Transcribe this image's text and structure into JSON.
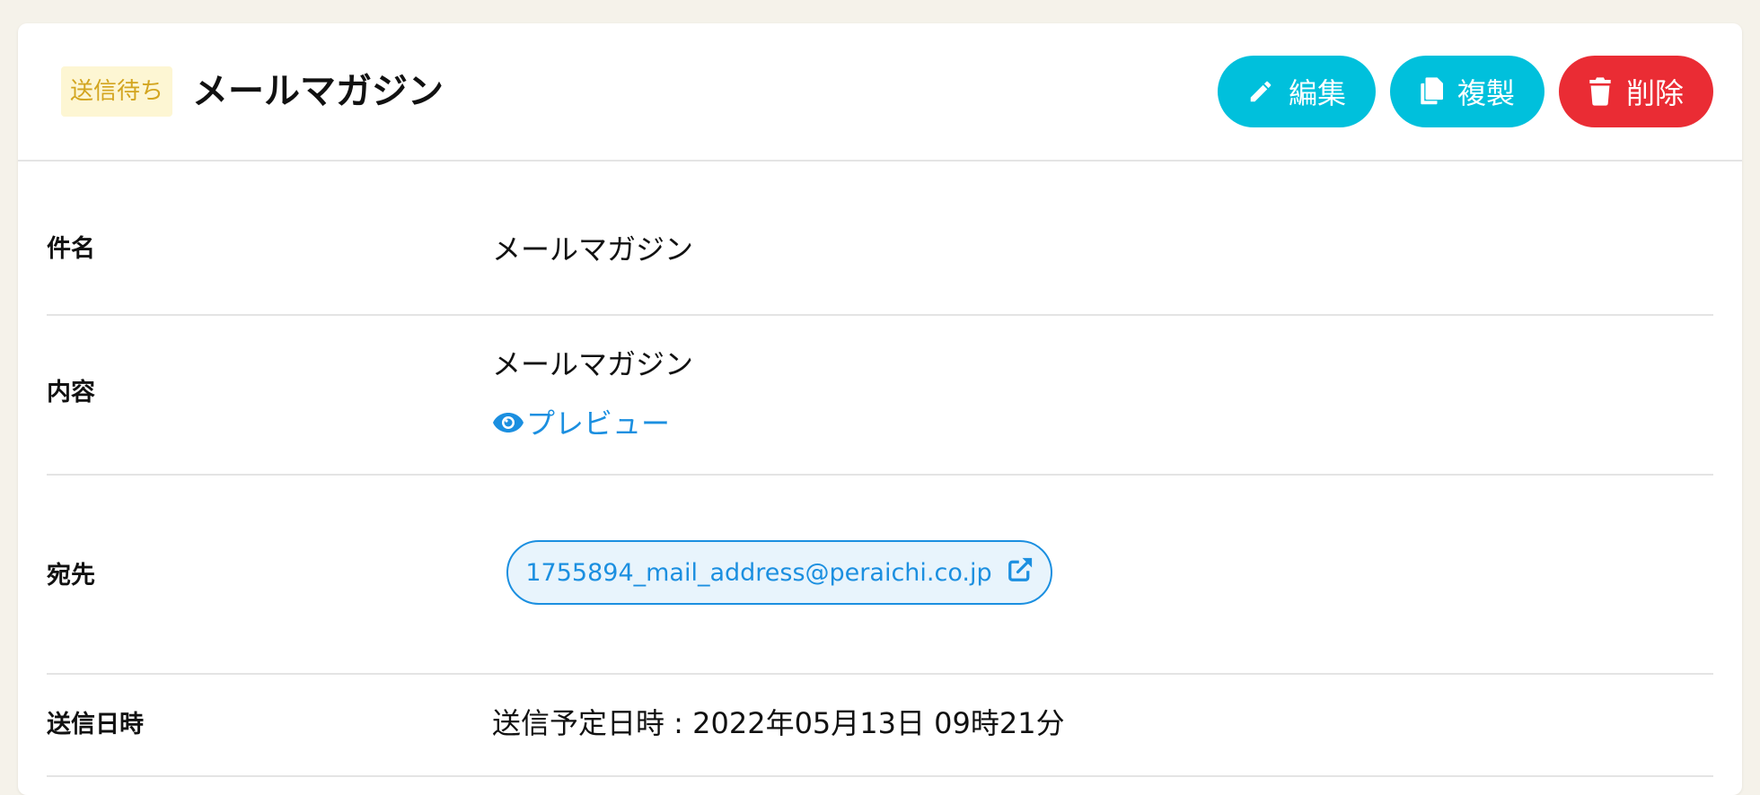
{
  "header": {
    "status_badge": "送信待ち",
    "title": "メールマガジン",
    "buttons": {
      "edit": "編集",
      "copy": "複製",
      "delete": "削除"
    }
  },
  "details": {
    "subject": {
      "label": "件名",
      "value": "メールマガジン"
    },
    "content": {
      "label": "内容",
      "value": "メールマガジン",
      "preview_link": "プレビュー"
    },
    "destination": {
      "label": "宛先",
      "email": "1755894_mail_address@peraichi.co.jp"
    },
    "send_datetime": {
      "label": "送信日時",
      "value": "送信予定日時 : 2022年05月13日 09時21分"
    }
  },
  "icons": {
    "edit": "pencil-icon",
    "copy": "copy-icon",
    "delete": "trash-icon",
    "preview": "eye-icon",
    "external": "external-link-icon"
  },
  "colors": {
    "accent_cyan": "#00c0dc",
    "danger_red": "#ea2c34",
    "link_blue": "#1b8fe0",
    "badge_bg": "#fdf6d3",
    "badge_text": "#d3a51f",
    "page_bg": "#f5f2ea"
  }
}
